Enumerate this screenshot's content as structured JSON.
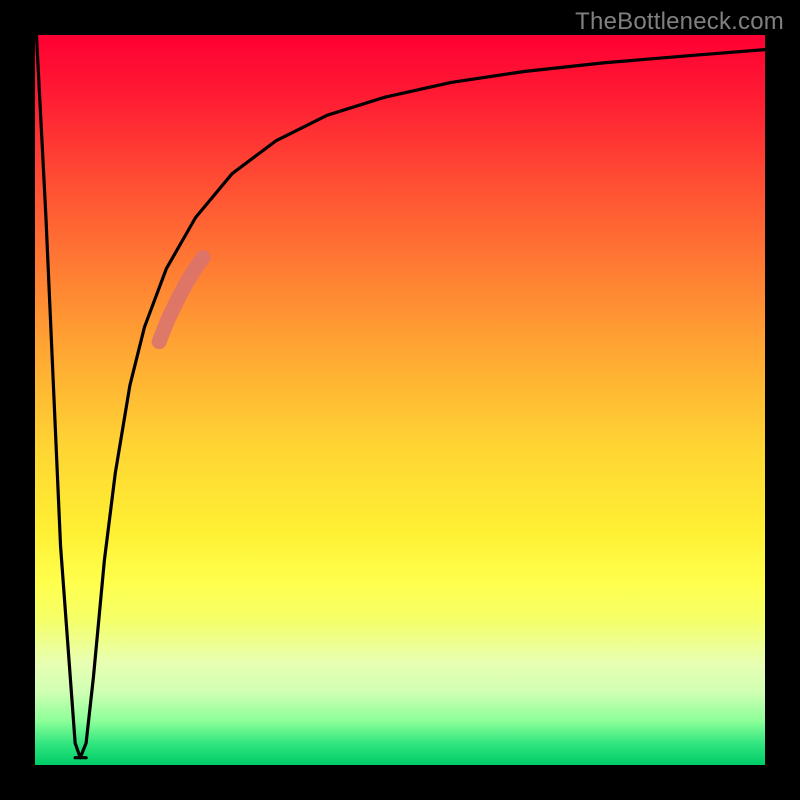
{
  "attribution": "TheBottleneck.com",
  "gradient_colors": {
    "top": "#ff0033",
    "mid_upper": "#ff8033",
    "mid": "#ffd633",
    "mid_lower": "#ffff4d",
    "bottom": "#00cc66"
  },
  "chart_data": {
    "type": "line",
    "title": "",
    "xlabel": "",
    "ylabel": "",
    "xlim": [
      0,
      100
    ],
    "ylim": [
      0,
      100
    ],
    "grid": false,
    "series": [
      {
        "name": "bottleneck-curve",
        "color": "#000000",
        "x": [
          0.2,
          1.5,
          3.5,
          5.5,
          6.2,
          7.0,
          8.0,
          9.5,
          11,
          13,
          15,
          18,
          22,
          27,
          33,
          40,
          48,
          57,
          67,
          78,
          90,
          100
        ],
        "y": [
          100,
          75,
          30,
          3,
          1,
          3,
          12,
          28,
          40,
          52,
          60,
          68,
          75,
          81,
          85.5,
          89,
          91.5,
          93.5,
          95,
          96.2,
          97.2,
          98
        ]
      },
      {
        "name": "highlight-segment",
        "color": "#d9736e",
        "x": [
          17.0,
          18.2,
          19.4,
          20.6,
          21.8,
          23.0
        ],
        "y": [
          58.0,
          61.0,
          63.5,
          65.8,
          67.8,
          69.5
        ]
      }
    ],
    "notch_bottom": {
      "x_start": 5.5,
      "x_end": 7.0,
      "y": 1
    }
  }
}
